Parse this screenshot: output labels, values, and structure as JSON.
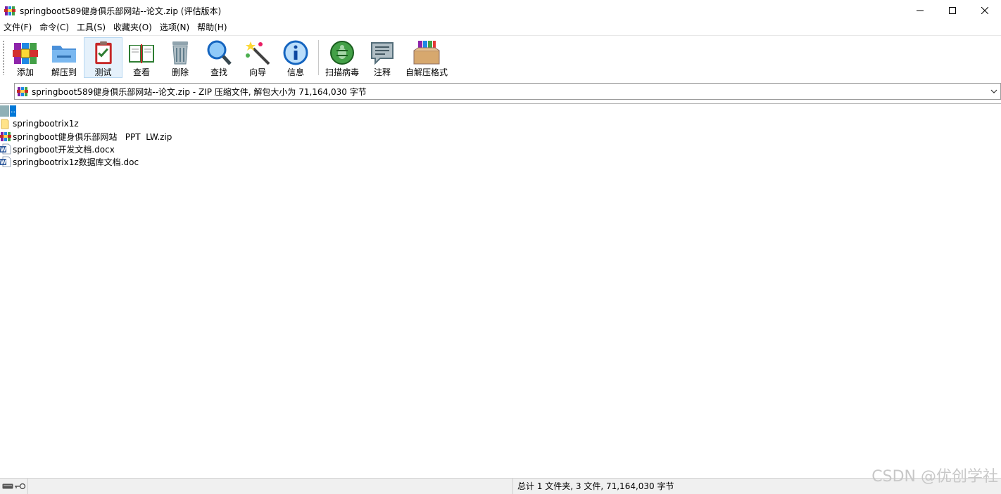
{
  "window": {
    "title": "springboot589健身俱乐部网站--论文.zip (评估版本)",
    "minimize": "─",
    "maximize": "☐",
    "close": "✕"
  },
  "menu": [
    "文件(F)",
    "命令(C)",
    "工具(S)",
    "收藏夹(O)",
    "选项(N)",
    "帮助(H)"
  ],
  "toolbar": {
    "buttons": [
      {
        "label": "添加",
        "icon": "add-archive-icon"
      },
      {
        "label": "解压到",
        "icon": "extract-to-icon"
      },
      {
        "label": "测试",
        "icon": "test-icon",
        "active": true
      },
      {
        "label": "查看",
        "icon": "view-book-icon"
      },
      {
        "label": "删除",
        "icon": "trash-icon"
      },
      {
        "label": "查找",
        "icon": "magnifier-icon"
      },
      {
        "label": "向导",
        "icon": "wizard-wand-icon"
      },
      {
        "label": "信息",
        "icon": "info-icon"
      },
      {
        "label": "扫描病毒",
        "icon": "virus-scan-icon"
      },
      {
        "label": "注释",
        "icon": "comment-icon"
      },
      {
        "label": "自解压格式",
        "icon": "sfx-box-icon"
      }
    ]
  },
  "address": {
    "text": "springboot589健身俱乐部网站--论文.zip - ZIP 压缩文件, 解包大小为 71,164,030 字节",
    "dropdown": "⌄"
  },
  "files": [
    {
      "name": "..",
      "type": "updir"
    },
    {
      "name": "springbootrix1z",
      "type": "folder"
    },
    {
      "name": "springboot健身俱乐部网站   PPT  LW.zip",
      "type": "zip"
    },
    {
      "name": "springboot开发文档.docx",
      "type": "word"
    },
    {
      "name": "springbootrix1z数据库文档.doc",
      "type": "word"
    }
  ],
  "status": {
    "summary": "总计 1 文件夹, 3 文件, 71,164,030 字节"
  },
  "watermark": "CSDN @优创学社",
  "colors": {
    "selection": "#0078d7",
    "active_button_bg": "#e5f1fb"
  }
}
